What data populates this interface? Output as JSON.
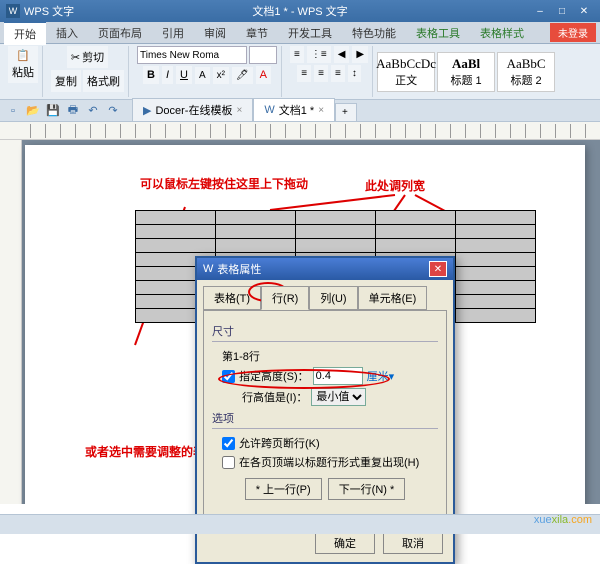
{
  "titlebar": {
    "app": "WPS 文字",
    "doc": "文档1 * - WPS 文字"
  },
  "menutabs": [
    "开始",
    "插入",
    "页面布局",
    "引用",
    "审阅",
    "章节",
    "开发工具",
    "特色功能",
    "表格工具",
    "表格样式"
  ],
  "login": "未登录",
  "ribbon": {
    "paste": "粘贴",
    "cut": "剪切",
    "copy": "复制",
    "fmt": "格式刷",
    "font": "Times New Roma",
    "styles": [
      {
        "prev": "AaBbCcDc",
        "name": "正文"
      },
      {
        "prev": "AaBl",
        "name": "标题 1"
      },
      {
        "prev": "AaBbC",
        "name": "标题 2"
      }
    ]
  },
  "doctabs": [
    {
      "label": "Docer-在线模板",
      "active": false
    },
    {
      "label": "文档1 *",
      "active": true
    }
  ],
  "annot": {
    "a1": "可以鼠标左键按住这里上下拖动",
    "a2": "此处调列宽",
    "a3": "或者选中需要调整的表格，右键  表格属性里调整"
  },
  "dialog": {
    "title": "表格属性",
    "tabs": [
      "表格(T)",
      "行(R)",
      "列(U)",
      "单元格(E)"
    ],
    "sec1": "尺寸",
    "rowrange": "第1-8行",
    "chkHeight": "指定高度(S)：",
    "heightVal": "0.4",
    "unit": "厘米",
    "heightIs": "行高值是(I)：",
    "heightMode": "最小值",
    "sec2": "选项",
    "chkBreak": "允许跨页断行(K)",
    "chkRepeat": "在各页顶端以标题行形式重复出现(H)",
    "prev": "* 上一行(P)",
    "next": "下一行(N) *",
    "ok": "确定",
    "cancel": "取消"
  },
  "watermark": {
    "p1": "xue",
    "p2": "xila",
    "p3": ".com"
  }
}
